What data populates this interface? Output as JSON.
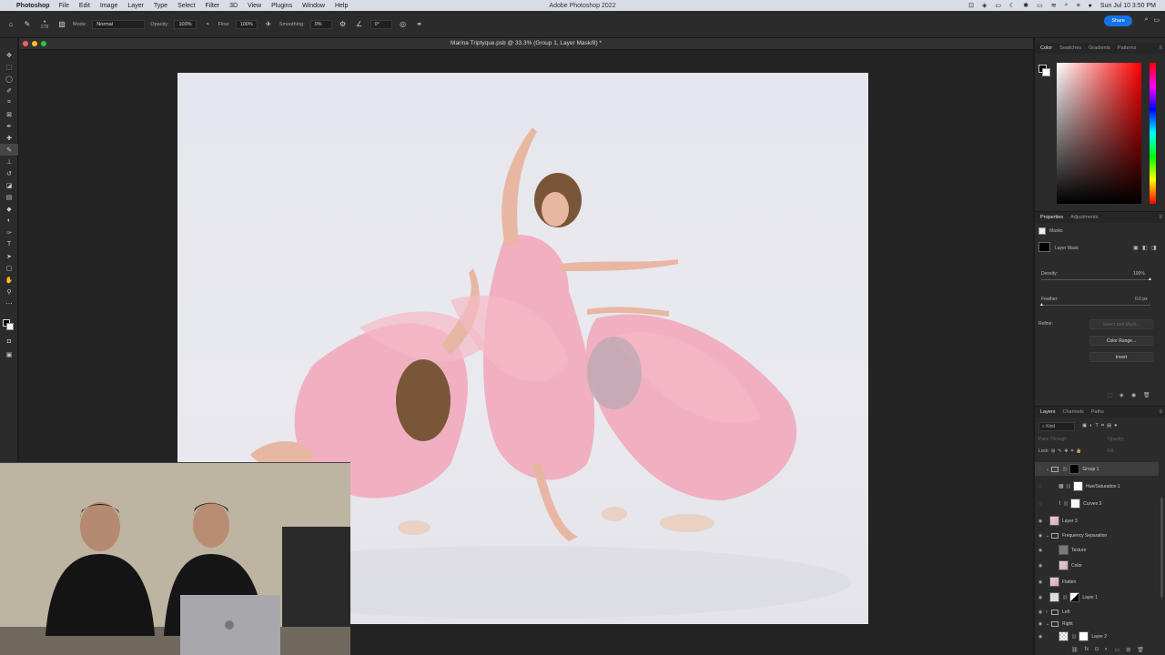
{
  "menubar": {
    "app_name": "Photoshop",
    "items": [
      "File",
      "Edit",
      "Image",
      "Layer",
      "Type",
      "Select",
      "Filter",
      "3D",
      "View",
      "Plugins",
      "Window",
      "Help"
    ],
    "window_title": "Adobe Photoshop 2022",
    "clock": "Sun Jul 10  3:50 PM"
  },
  "options": {
    "brush_size": "278",
    "mode_label": "Mode:",
    "mode_value": "Normal",
    "opacity_label": "Opacity:",
    "opacity_value": "100%",
    "flow_label": "Flow:",
    "flow_value": "100%",
    "smoothing_label": "Smoothing:",
    "smoothing_value": "0%",
    "angle_value": "0°",
    "share_label": "Share"
  },
  "document": {
    "title": "Marina Triptyque.psb @ 33.3% (Group 1, Layer Mask/8) *"
  },
  "color_panel": {
    "tabs": [
      "Color",
      "Swatches",
      "Gradients",
      "Patterns"
    ]
  },
  "properties": {
    "tabs": [
      "Properties",
      "Adjustments"
    ],
    "section": "Masks",
    "mask_type": "Layer Mask",
    "density_label": "Density:",
    "density_value": "100%",
    "feather_label": "Feather:",
    "feather_value": "0.0 px",
    "refine_label": "Refine:",
    "select_mask_label": "Select and Mask...",
    "color_range_label": "Color Range...",
    "invert_label": "Invert"
  },
  "layers_panel": {
    "tabs": [
      "Layers",
      "Channels",
      "Paths"
    ],
    "kind_filter": "Kind",
    "blend_mode": "Pass Through",
    "opacity_label": "Opacity:",
    "lock_label": "Lock:",
    "fill_label": "Fill:",
    "layers": [
      {
        "name": "Group 1"
      },
      {
        "name": "Hue/Saturation 1"
      },
      {
        "name": "Curves 3"
      },
      {
        "name": "Layer 3"
      },
      {
        "name": "Frequency Separation"
      },
      {
        "name": "Texture"
      },
      {
        "name": "Color"
      },
      {
        "name": "Flatten"
      },
      {
        "name": "Layer 1"
      },
      {
        "name": "Left"
      },
      {
        "name": "Right"
      },
      {
        "name": "Layer 2"
      }
    ]
  }
}
